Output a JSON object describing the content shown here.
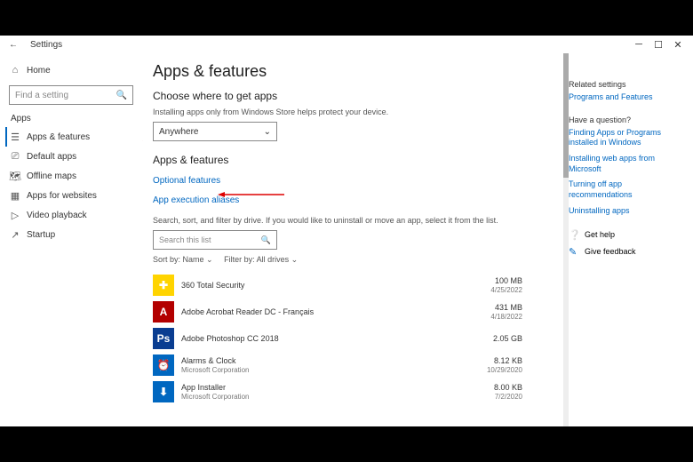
{
  "titlebar": {
    "title": "Settings"
  },
  "sidebar": {
    "home": "Home",
    "search_placeholder": "Find a setting",
    "heading": "Apps",
    "items": [
      {
        "label": "Apps & features"
      },
      {
        "label": "Default apps"
      },
      {
        "label": "Offline maps"
      },
      {
        "label": "Apps for websites"
      },
      {
        "label": "Video playback"
      },
      {
        "label": "Startup"
      }
    ]
  },
  "main": {
    "title": "Apps & features",
    "choose_heading": "Choose where to get apps",
    "choose_sub": "Installing apps only from Windows Store helps protect your device.",
    "choose_dropdown": "Anywhere",
    "apps_heading": "Apps & features",
    "optional_link": "Optional features",
    "aliases_link": "App execution aliases",
    "search_instructions": "Search, sort, and filter by drive. If you would like to uninstall or move an app, select it from the list.",
    "search_placeholder": "Search this list",
    "sort_label": "Sort by:",
    "sort_value": "Name",
    "filter_label": "Filter by:",
    "filter_value": "All drives",
    "apps": [
      {
        "name": "360 Total Security",
        "publisher": "",
        "size": "100 MB",
        "date": "4/25/2022",
        "bg": "#ffd400",
        "glyph": "✚"
      },
      {
        "name": "Adobe Acrobat Reader DC - Français",
        "publisher": "",
        "size": "431 MB",
        "date": "4/18/2022",
        "bg": "#b30000",
        "glyph": "A"
      },
      {
        "name": "Adobe Photoshop CC 2018",
        "publisher": "",
        "size": "2.05 GB",
        "date": "",
        "bg": "#0a3d91",
        "glyph": "Ps"
      },
      {
        "name": "Alarms & Clock",
        "publisher": "Microsoft Corporation",
        "size": "8.12 KB",
        "date": "10/29/2020",
        "bg": "#0067c0",
        "glyph": "⏰"
      },
      {
        "name": "App Installer",
        "publisher": "Microsoft Corporation",
        "size": "8.00 KB",
        "date": "7/2/2020",
        "bg": "#0067c0",
        "glyph": "⬇"
      }
    ]
  },
  "right": {
    "related_heading": "Related settings",
    "related_link": "Programs and Features",
    "question_heading": "Have a question?",
    "question_links": [
      "Finding Apps or Programs installed in Windows",
      "Installing web apps from Microsoft",
      "Turning off app recommendations",
      "Uninstalling apps"
    ],
    "help": "Get help",
    "feedback": "Give feedback"
  }
}
